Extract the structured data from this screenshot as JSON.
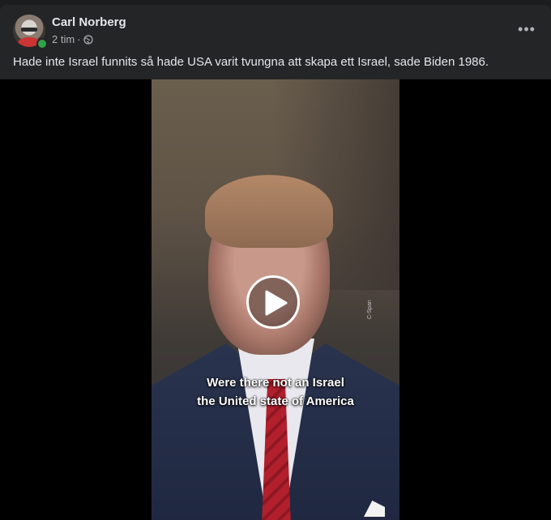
{
  "post": {
    "author": "Carl Norberg",
    "timestamp": "2 tim",
    "separator": "·",
    "privacy_icon": "globe-icon",
    "more_icon": "more-horizontal-icon",
    "more_label": "•••",
    "caption": "Hade inte Israel funnits så hade USA varit tvungna att skapa ett Israel, sade Biden 1986."
  },
  "video": {
    "subtitle_line1": "Were there not an Israel",
    "subtitle_line2": "the United state of America",
    "watermark": "C-Span",
    "play_icon": "play-icon"
  },
  "colors": {
    "background": "#242526",
    "text": "#e4e6eb",
    "secondary_text": "#b0b3b8",
    "online": "#31a24c"
  }
}
